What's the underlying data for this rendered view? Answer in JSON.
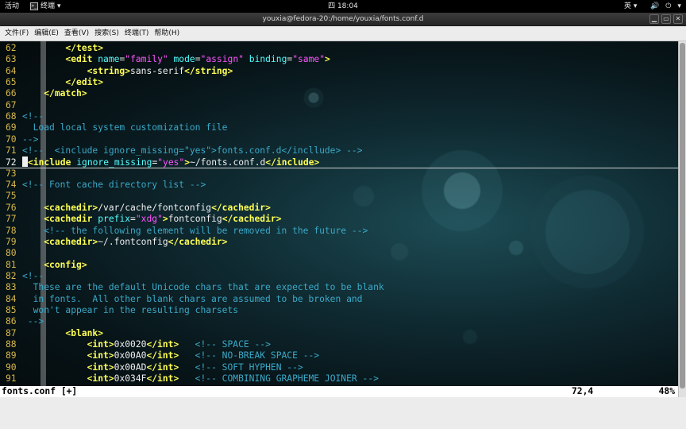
{
  "topbar": {
    "activities": "活动",
    "app_menu": "终端",
    "app_menu_arrow": "▾",
    "clock": "四 18:04",
    "input_method": "英",
    "input_arrow": "▾",
    "volume_icon": "🔊",
    "power_icon": "⏻",
    "power_arrow": "▾"
  },
  "window": {
    "title": "youxia@fedora-20:/home/youxia/fonts.conf.d",
    "controls": [
      "▁",
      "▭",
      "✕"
    ]
  },
  "menubar": [
    "文件(F)",
    "编辑(E)",
    "查看(V)",
    "搜索(S)",
    "终端(T)",
    "帮助(H)"
  ],
  "editor": {
    "cursor_line": 72,
    "lines": [
      {
        "n": "62",
        "t": [
          [
            "        ",
            "txt"
          ],
          [
            "</test>",
            "tag"
          ]
        ]
      },
      {
        "n": "63",
        "t": [
          [
            "        ",
            "txt"
          ],
          [
            "<edit ",
            "tag"
          ],
          [
            "name",
            "attr"
          ],
          [
            "=",
            "op"
          ],
          [
            "\"family\"",
            "str"
          ],
          [
            " ",
            "txt"
          ],
          [
            "mode",
            "attr"
          ],
          [
            "=",
            "op"
          ],
          [
            "\"assign\"",
            "str"
          ],
          [
            " ",
            "txt"
          ],
          [
            "binding",
            "attr"
          ],
          [
            "=",
            "op"
          ],
          [
            "\"same\"",
            "str"
          ],
          [
            ">",
            "tag"
          ]
        ]
      },
      {
        "n": "64",
        "t": [
          [
            "            ",
            "txt"
          ],
          [
            "<string>",
            "tag"
          ],
          [
            "sans-serif",
            "txt"
          ],
          [
            "</string>",
            "tag"
          ]
        ]
      },
      {
        "n": "65",
        "t": [
          [
            "        ",
            "txt"
          ],
          [
            "</edit>",
            "tag"
          ]
        ]
      },
      {
        "n": "66",
        "t": [
          [
            "    ",
            "txt"
          ],
          [
            "</match>",
            "tag"
          ]
        ]
      },
      {
        "n": "67",
        "t": []
      },
      {
        "n": "68",
        "t": [
          [
            "<!--",
            "cmt"
          ]
        ]
      },
      {
        "n": "69",
        "t": [
          [
            "  Load local system customization file",
            "cmt"
          ]
        ]
      },
      {
        "n": "70",
        "t": [
          [
            "-->",
            "cmt"
          ]
        ]
      },
      {
        "n": "71",
        "t": [
          [
            "<!--  <include ignore_missing=\"yes\">fonts.conf.d</incllude> -->",
            "cmt"
          ]
        ]
      },
      {
        "n": "72",
        "t": [
          [
            "    ",
            "cur"
          ],
          [
            "<include ",
            "tag"
          ],
          [
            "ignore_missing",
            "attr"
          ],
          [
            "=",
            "op"
          ],
          [
            "\"yes\"",
            "str"
          ],
          [
            ">",
            "tag"
          ],
          [
            "~/fonts.conf.d",
            "txt"
          ],
          [
            "</include>",
            "tag"
          ]
        ]
      },
      {
        "n": "73",
        "t": []
      },
      {
        "n": "74",
        "t": [
          [
            "<!-- Font cache directory list -->",
            "cmt"
          ]
        ]
      },
      {
        "n": "75",
        "t": []
      },
      {
        "n": "76",
        "t": [
          [
            "    ",
            "txt"
          ],
          [
            "<cachedir>",
            "tag"
          ],
          [
            "/var/cache/fontconfig",
            "txt"
          ],
          [
            "</cachedir>",
            "tag"
          ]
        ]
      },
      {
        "n": "77",
        "t": [
          [
            "    ",
            "txt"
          ],
          [
            "<cachedir ",
            "tag"
          ],
          [
            "prefix",
            "attr"
          ],
          [
            "=",
            "op"
          ],
          [
            "\"xdg\"",
            "str"
          ],
          [
            ">",
            "tag"
          ],
          [
            "fontconfig",
            "txt"
          ],
          [
            "</cachedir>",
            "tag"
          ]
        ]
      },
      {
        "n": "78",
        "t": [
          [
            "    ",
            "txt"
          ],
          [
            "<!-- the following element will be removed in the future -->",
            "cmt"
          ]
        ]
      },
      {
        "n": "79",
        "t": [
          [
            "    ",
            "txt"
          ],
          [
            "<cachedir>",
            "tag"
          ],
          [
            "~/.fontconfig",
            "txt"
          ],
          [
            "</cachedir>",
            "tag"
          ]
        ]
      },
      {
        "n": "80",
        "t": []
      },
      {
        "n": "81",
        "t": [
          [
            "    ",
            "txt"
          ],
          [
            "<config>",
            "tag"
          ]
        ]
      },
      {
        "n": "82",
        "t": [
          [
            "<!--",
            "cmt"
          ]
        ]
      },
      {
        "n": "83",
        "t": [
          [
            "  These are the default Unicode chars that are expected to be blank",
            "cmt"
          ]
        ]
      },
      {
        "n": "84",
        "t": [
          [
            "  in fonts.  All other blank chars are assumed to be broken and",
            "cmt"
          ]
        ]
      },
      {
        "n": "85",
        "t": [
          [
            "  won't appear in the resulting charsets",
            "cmt"
          ]
        ]
      },
      {
        "n": "86",
        "t": [
          [
            " -->",
            "cmt"
          ]
        ]
      },
      {
        "n": "87",
        "t": [
          [
            "        ",
            "txt"
          ],
          [
            "<blank>",
            "tag"
          ]
        ]
      },
      {
        "n": "88",
        "t": [
          [
            "            ",
            "txt"
          ],
          [
            "<int>",
            "tag"
          ],
          [
            "0x0020",
            "txt"
          ],
          [
            "</int>",
            "tag"
          ],
          [
            "   ",
            "txt"
          ],
          [
            "<!-- SPACE -->",
            "cmt"
          ]
        ]
      },
      {
        "n": "89",
        "t": [
          [
            "            ",
            "txt"
          ],
          [
            "<int>",
            "tag"
          ],
          [
            "0x00A0",
            "txt"
          ],
          [
            "</int>",
            "tag"
          ],
          [
            "   ",
            "txt"
          ],
          [
            "<!-- NO-BREAK SPACE -->",
            "cmt"
          ]
        ]
      },
      {
        "n": "90",
        "t": [
          [
            "            ",
            "txt"
          ],
          [
            "<int>",
            "tag"
          ],
          [
            "0x00AD",
            "txt"
          ],
          [
            "</int>",
            "tag"
          ],
          [
            "   ",
            "txt"
          ],
          [
            "<!-- SOFT HYPHEN -->",
            "cmt"
          ]
        ]
      },
      {
        "n": "91",
        "t": [
          [
            "            ",
            "txt"
          ],
          [
            "<int>",
            "tag"
          ],
          [
            "0x034F",
            "txt"
          ],
          [
            "</int>",
            "tag"
          ],
          [
            "   ",
            "txt"
          ],
          [
            "<!-- COMBINING GRAPHEME JOINER -->",
            "cmt"
          ]
        ]
      }
    ]
  },
  "statusline": {
    "file": "fonts.conf [+]",
    "position": "72,4",
    "percent": "48%"
  },
  "scrollbar": {
    "thumb_start": 0.0,
    "thumb_fraction": 0.98
  }
}
